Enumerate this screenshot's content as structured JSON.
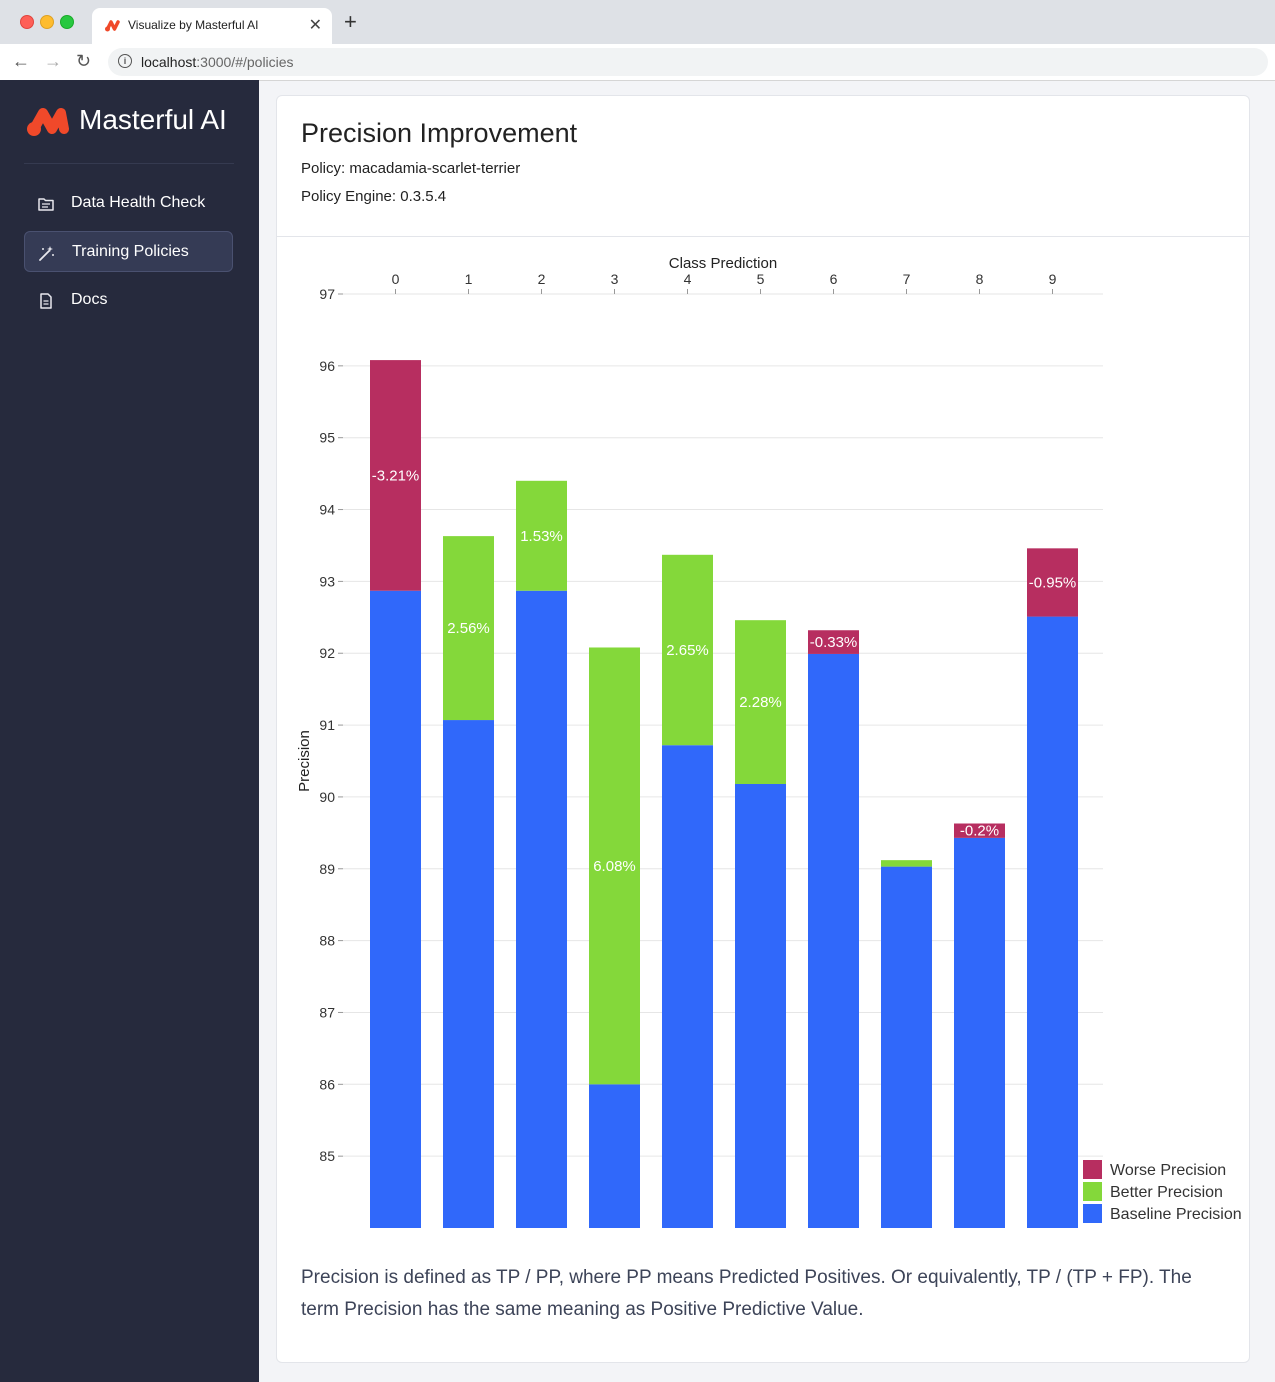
{
  "browser": {
    "tab_title": "Visualize by Masterful AI",
    "close_glyph": "✕",
    "new_tab_glyph": "+",
    "url_host": "localhost",
    "url_rest": ":3000/#/policies",
    "back_glyph": "←",
    "forward_glyph": "→",
    "reload_glyph": "↻"
  },
  "sidebar": {
    "brand": "Masterful AI",
    "brand_color": "#f0492a",
    "items": [
      {
        "label": "Data Health Check",
        "icon": "folder-icon",
        "active": false
      },
      {
        "label": "Training Policies",
        "icon": "magic-wand-icon",
        "active": true
      },
      {
        "label": "Docs",
        "icon": "document-icon",
        "active": false
      }
    ]
  },
  "card": {
    "title": "Precision Improvement",
    "policy": "Policy: macadamia-scarlet-terrier",
    "engine": "Policy Engine: 0.3.5.4",
    "footnote": "Precision is defined as TP / PP, where PP means Predicted Positives. Or equivalently, TP / (TP + FP). The term Precision has the same meaning as Positive Predictive Value."
  },
  "chart_data": {
    "type": "bar",
    "stacked": true,
    "xlabel": "Class Prediction",
    "ylabel": "Precision",
    "x_axis_position": "top",
    "ylim": [
      84,
      97
    ],
    "yticks": [
      85,
      86,
      87,
      88,
      89,
      90,
      91,
      92,
      93,
      94,
      95,
      96,
      97
    ],
    "grid": true,
    "legend_position": "bottom-right",
    "categories": [
      "0",
      "1",
      "2",
      "3",
      "4",
      "5",
      "6",
      "7",
      "8",
      "9"
    ],
    "series": [
      {
        "name": "Baseline Precision",
        "color": "#3068fa",
        "values": [
          92.87,
          91.07,
          92.87,
          86.0,
          90.72,
          90.18,
          91.99,
          89.03,
          89.43,
          92.51
        ]
      },
      {
        "name": "Better Precision",
        "color": "#84d83a",
        "values": [
          0,
          2.56,
          1.53,
          6.08,
          2.65,
          2.28,
          0,
          0.09,
          0,
          0
        ]
      },
      {
        "name": "Worse Precision",
        "color": "#b72e60",
        "values": [
          3.21,
          0,
          0,
          0,
          0,
          0,
          0.33,
          0,
          0.2,
          0.95
        ]
      }
    ],
    "data_labels": [
      "-3.21%",
      "2.56%",
      "1.53%",
      "6.08%",
      "2.65%",
      "2.28%",
      "-0.33%",
      "",
      "-0.2%",
      "-0.95%"
    ],
    "legend_order": [
      "Worse Precision",
      "Better Precision",
      "Baseline Precision"
    ]
  }
}
